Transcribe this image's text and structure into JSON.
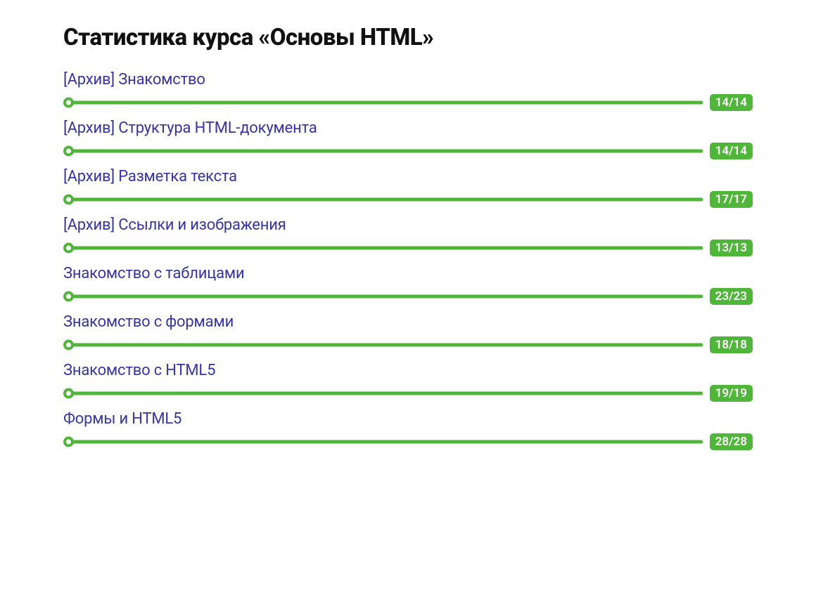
{
  "title": "Статистика курса «Основы HTML»",
  "accentColor": "#4fb63a",
  "linkColor": "#3634a3",
  "modules": [
    {
      "name": "[Архив] Знакомство",
      "done": 14,
      "total": 14
    },
    {
      "name": "[Архив] Структура HTML-документа",
      "done": 14,
      "total": 14
    },
    {
      "name": "[Архив] Разметка текста",
      "done": 17,
      "total": 17
    },
    {
      "name": "[Архив] Ссылки и изображения",
      "done": 13,
      "total": 13
    },
    {
      "name": "Знакомство с таблицами",
      "done": 23,
      "total": 23
    },
    {
      "name": "Знакомство с формами",
      "done": 18,
      "total": 18
    },
    {
      "name": "Знакомство с HTML5",
      "done": 19,
      "total": 19
    },
    {
      "name": "Формы и HTML5",
      "done": 28,
      "total": 28
    }
  ]
}
